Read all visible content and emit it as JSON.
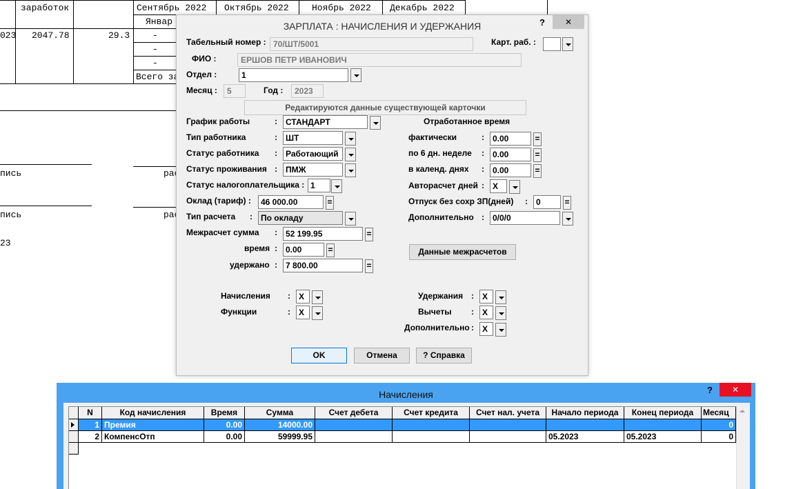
{
  "background": {
    "months": [
      "Сентябрь 2022",
      "Октябрь 2022",
      "Ноябрь 2022",
      "Декабрь 2022"
    ],
    "earnings_header": "заработок",
    "january_partial": "Январ",
    "row_year_partial": "023",
    "row_amount": "2047.78",
    "row_value": "29.3",
    "dash": "-",
    "total_partial": "Всего за",
    "sig_partial_1": "пись",
    "sig_right_1": "рас",
    "sig_partial_2": "пись",
    "sig_right_2": "рас",
    "year_partial": "23"
  },
  "dialog": {
    "title": "ЗАРПЛАТА : НАЧИСЛЕНИЯ И УДЕРЖАНИЯ",
    "help": "?",
    "close": "✕",
    "tab_number_label": "Табельный номер :",
    "tab_number_value": "70/ШТ/5001",
    "card_label": "Карт. раб.   :",
    "card_value": "",
    "fio_label": "ФИО   :",
    "fio_value": "ЕРШОВ ПЕТР ИВАНОВИЧ",
    "dept_label": "Отдел   :",
    "dept_value": "1",
    "month_label": "Месяц :",
    "month_value": "5",
    "year_label": "Год  :",
    "year_value": "2023",
    "notice": "Редактируются данные существующей карточки",
    "schedule_label": "График работы",
    "schedule_value": "СТАНДАРТ",
    "worker_type_label": "Тип работника",
    "worker_type_value": "ШТ",
    "worker_status_label": "Статус работника",
    "worker_status_value": "Работающий",
    "residence_label": "Статус проживания",
    "residence_value": "ПМЖ",
    "taxpayer_label": "Статус налогоплательщика :",
    "taxpayer_value": "1",
    "salary_label": "Оклад (тариф)  :",
    "salary_value": "46 000.00",
    "calc_type_label": "Тип расчета",
    "calc_type_value": "По окладу",
    "inter_label": "Межрасчет   сумма",
    "inter_sum_value": "52 199.95",
    "inter_time_label": "время",
    "inter_time_value": "0.00",
    "inter_withheld_label": "удержано",
    "inter_withheld_value": "7 800.00",
    "colon": ":",
    "eq": "=",
    "worked_title": "Отработанное время",
    "actual_label": "фактически",
    "actual_value": "0.00",
    "six_day_label": "по 6 дн. неделе",
    "six_day_value": "0.00",
    "calendar_label": "в календ. днях",
    "calendar_value": "0.00",
    "autocalc_label": "Авторасчет дней",
    "autocalc_value": "X",
    "unpaid_label": "Отпуск без сохр ЗП(дней)",
    "unpaid_value": "0",
    "additional_label": "Дополнительно",
    "additional_value": "0/0/0",
    "inter_data_button": "Данные межрасчетов",
    "accruals_label": "Начисления",
    "accruals_value": "X",
    "functions_label": "Функции",
    "functions_value": "X",
    "withholdings_label": "Удержания",
    "withholdings_value": "X",
    "deductions_label": "Вычеты",
    "deductions_value": "X",
    "additional2_label": "Дополнительно",
    "additional2_value": "X",
    "ok_button": "OK",
    "cancel_button": "Отмена",
    "help_button": "? Справка"
  },
  "accruals_window": {
    "title": "Начисления",
    "help": "?",
    "close": "✕",
    "columns": [
      "N",
      "Код начисления",
      "Время",
      "Сумма",
      "Счет дебета",
      "Счет кредита",
      "Счет нал. учета",
      "Начало периода",
      "Конец периода",
      "Месяц"
    ],
    "rows": [
      {
        "n": "1",
        "code": "Премия",
        "time": "0.00",
        "sum": "14000.00",
        "debit": "",
        "credit": "",
        "tax": "",
        "start": "",
        "end": "",
        "month": "0"
      },
      {
        "n": "2",
        "code": "КомпенсОтп",
        "time": "0.00",
        "sum": "59999.95",
        "debit": "",
        "credit": "",
        "tax": "",
        "start": "05.2023",
        "end": "05.2023",
        "month": "0"
      }
    ]
  },
  "colors": {
    "accent": "#3399ff",
    "window_border": "#4aa3f0",
    "close_red": "#e81123"
  }
}
